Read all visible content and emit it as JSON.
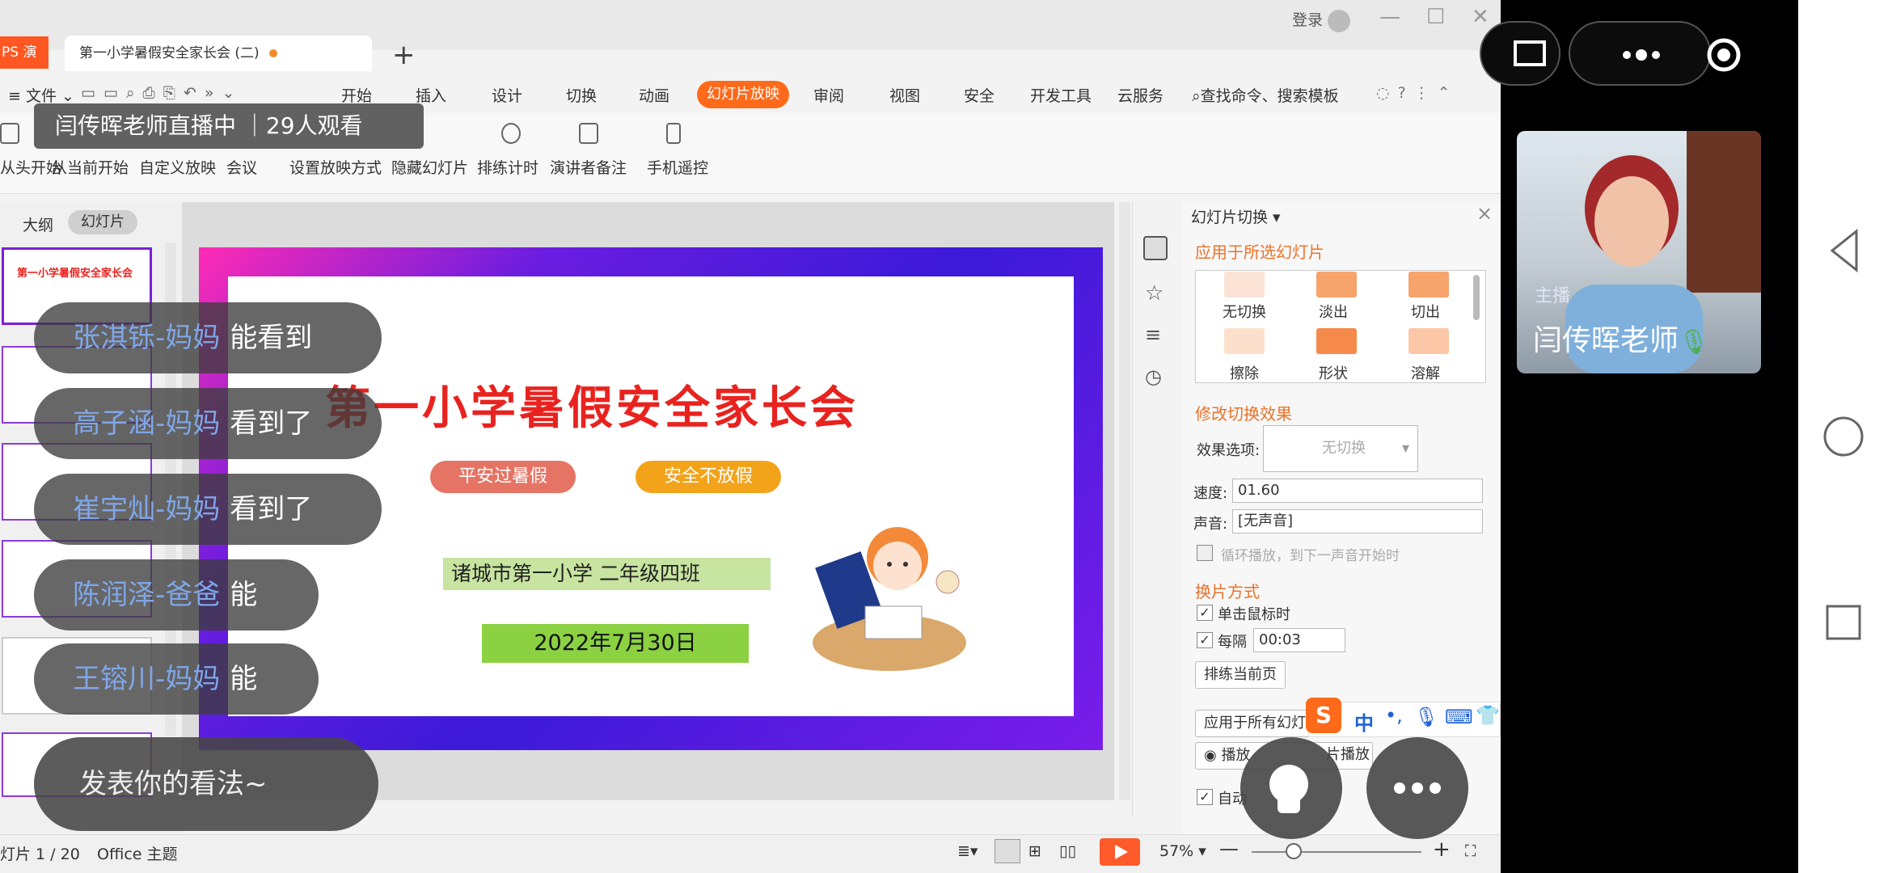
{
  "app": {
    "app_tab": "PS 演示",
    "doc_tab": "第一小学暑假安全家长会 (二)",
    "login": "登录"
  },
  "menu": {
    "file": "文件",
    "items": [
      "开始",
      "插入",
      "设计",
      "切换",
      "动画",
      "幻灯片放映",
      "审阅",
      "视图",
      "安全",
      "开发工具",
      "云服务"
    ],
    "active": "幻灯片放映",
    "search": "查找命令、搜索模板"
  },
  "ribbon": {
    "items": [
      "从头开始",
      "从当前开始",
      "自定义放映",
      "会议",
      "设置放映方式",
      "隐藏幻灯片",
      "排练计时",
      "演讲者备注",
      "手机遥控"
    ]
  },
  "left_pane": {
    "tab_outline": "大纲",
    "tab_slides": "幻灯片"
  },
  "slide": {
    "title": "第一小学暑假安全家长会",
    "pill1": "平安过暑假",
    "pill2": "安全不放假",
    "school": "诸城市第一小学   二年级四班",
    "date": "2022年7月30日"
  },
  "panel": {
    "title": "幻灯片切换",
    "apply_selected": "应用于所选幻灯片",
    "effects": [
      "无切换",
      "淡出",
      "切出",
      "擦除",
      "形状",
      "溶解"
    ],
    "modify": "修改切换效果",
    "effect_opt_label": "效果选项:",
    "effect_opt_value": "无切换",
    "speed_label": "速度:",
    "speed_value": "01.60",
    "sound_label": "声音:",
    "sound_value": "[无声音]",
    "loop": "循环播放，到下一声音开始时",
    "advance": "换片方式",
    "on_click": "单击鼠标时",
    "every": "每隔",
    "every_value": "00:03",
    "rehearse": "排练当前页",
    "apply_all": "应用于所有幻灯",
    "play": "播放",
    "slideshow": "片播放",
    "auto": "自动"
  },
  "status": {
    "slide_info": "灯片 1 / 20",
    "theme": "Office 主题",
    "zoom": "57%"
  },
  "live": {
    "banner": "闫传晖老师直播中 ｜29人观看",
    "messages": [
      {
        "name": "张淇铄-妈妈",
        "text": "能看到"
      },
      {
        "name": "高子涵-妈妈",
        "text": "看到了"
      },
      {
        "name": "崔宇灿-妈妈",
        "text": "看到了"
      },
      {
        "name": "陈润泽-爸爸",
        "text": "能"
      },
      {
        "name": "王镕川-妈妈",
        "text": "能"
      }
    ],
    "input_placeholder": "发表你的看法~",
    "host_tag": "主播",
    "host_name": "闫传晖老师"
  },
  "sogou": {
    "zh": "中"
  }
}
